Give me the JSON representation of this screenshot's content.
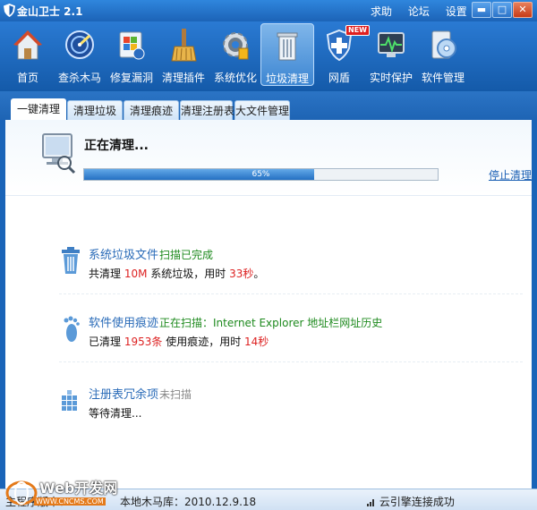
{
  "app": {
    "title": "金山卫士 2.1"
  },
  "top_links": [
    "求助",
    "论坛",
    "设置"
  ],
  "window_controls": {
    "minimize": "▬",
    "maximize": "□",
    "close": "✕"
  },
  "toolbar": [
    {
      "label": "首页",
      "icon": "home-icon"
    },
    {
      "label": "查杀木马",
      "icon": "scan-icon"
    },
    {
      "label": "修复漏洞",
      "icon": "windows-patch-icon"
    },
    {
      "label": "清理插件",
      "icon": "broom-icon"
    },
    {
      "label": "系统优化",
      "icon": "gear-icon"
    },
    {
      "label": "垃圾清理",
      "icon": "trash-icon",
      "active": true
    },
    {
      "label": "网盾",
      "icon": "shield-icon",
      "badge": "NEW"
    },
    {
      "label": "实时保护",
      "icon": "monitor-pulse-icon"
    },
    {
      "label": "软件管理",
      "icon": "software-disc-icon"
    }
  ],
  "tabs": [
    "一键清理",
    "清理垃圾",
    "清理痕迹",
    "清理注册表",
    "大文件管理"
  ],
  "status": {
    "title": "正在清理...",
    "progress_percent": 65,
    "progress_text": "65%",
    "stop_label": "停止清理"
  },
  "items": [
    {
      "name": "系统垃圾文件",
      "state": "扫描已完成",
      "detail": {
        "prefix": "共清理 ",
        "value1": "10M",
        "mid": " 系统垃圾，用时 ",
        "value2": "33秒",
        "suffix": "。"
      }
    },
    {
      "name": "软件使用痕迹",
      "state": "正在扫描：Internet Explorer 地址栏网址历史",
      "detail": {
        "prefix": "已清理 ",
        "value1": "1953条",
        "mid": " 使用痕迹，用时 ",
        "value2": "14秒",
        "suffix": ""
      }
    },
    {
      "name": "注册表冗余项",
      "state": "未扫描",
      "detail": {
        "prefix": "等待清理...",
        "value1": "",
        "mid": "",
        "value2": "",
        "suffix": ""
      }
    }
  ],
  "footer": {
    "left": "主程序版本：",
    "db": "本地木马库：2010.12.9.18",
    "connection": "云引擎连接成功"
  },
  "watermark": {
    "text": "Web开发网",
    "sub": "WWW.CNCMS.COM"
  },
  "colors": {
    "accent": "#1c63b7",
    "value_red": "#d22222",
    "done_green": "#1e8a1e",
    "link_blue": "#1a5fb4"
  }
}
